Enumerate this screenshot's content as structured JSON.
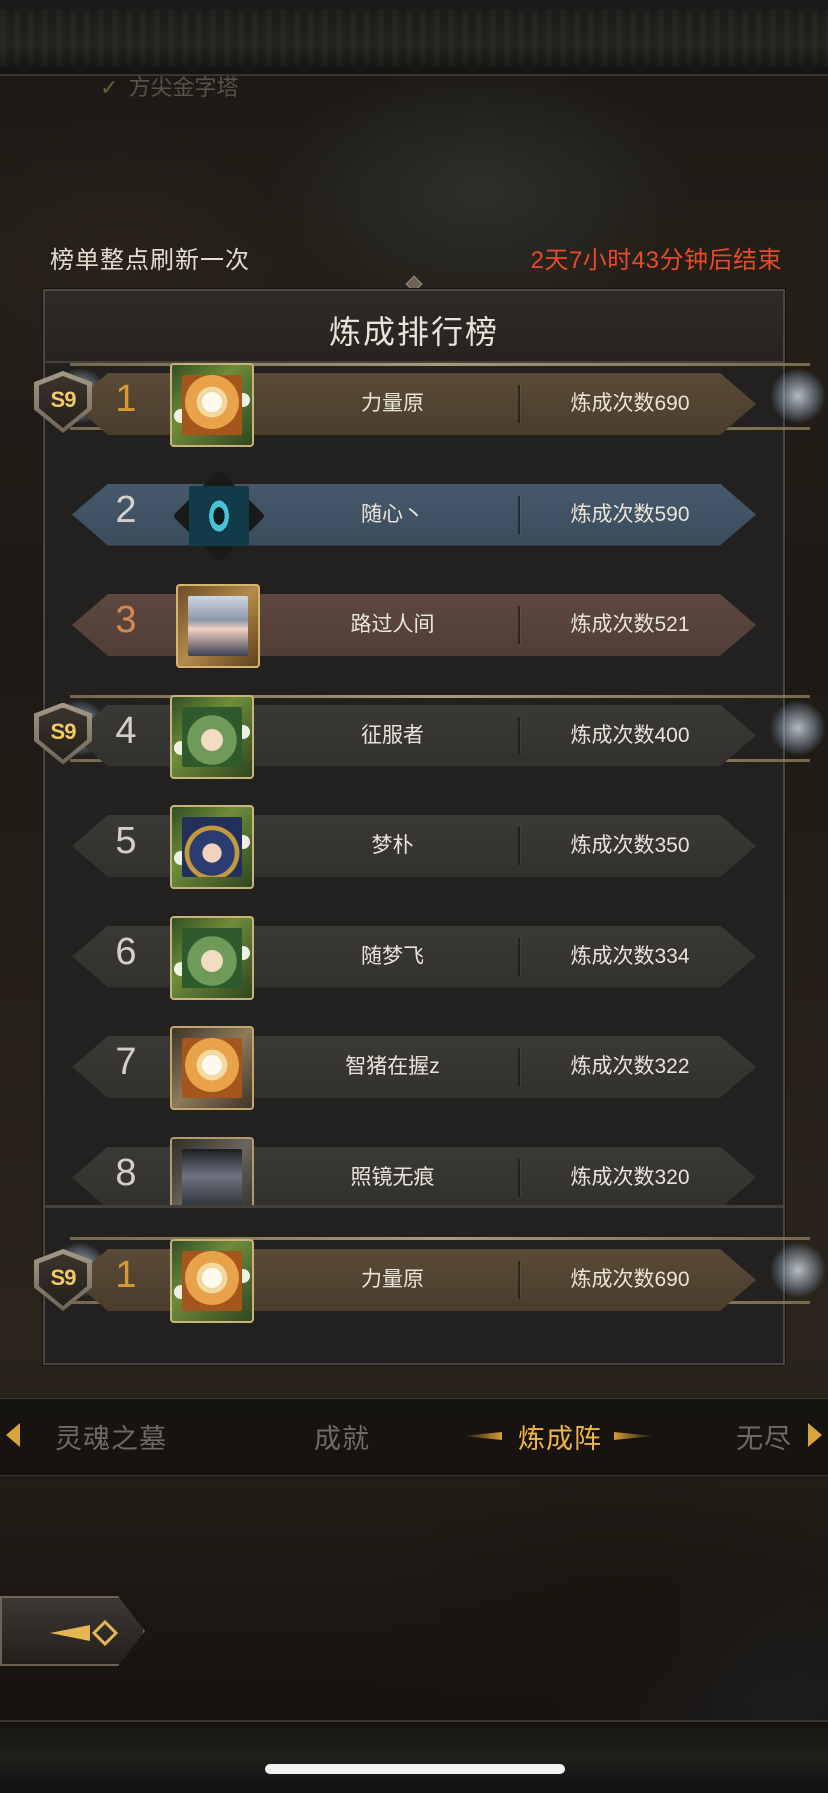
{
  "header": {
    "faded_label": "方尖金字塔",
    "refresh_note": "榜单整点刷新一次",
    "countdown": "2天7小时43分钟后结束"
  },
  "panel": {
    "title": "炼成排行榜"
  },
  "rows": [
    {
      "rank": "1",
      "name": "力量原",
      "score": "炼成次数690",
      "badge": "S9",
      "style": "gold",
      "avatar": "rabbit-avatar"
    },
    {
      "rank": "2",
      "name": "随心丶",
      "score": "炼成次数590",
      "badge": "",
      "style": "blue",
      "avatar": "eye-avatar"
    },
    {
      "rank": "3",
      "name": "路过人间",
      "score": "炼成次数521",
      "badge": "",
      "style": "bronze",
      "avatar": "elf-avatar"
    },
    {
      "rank": "4",
      "name": "征服者",
      "score": "炼成次数400",
      "badge": "S9",
      "style": "gray",
      "avatar": "green-hair-avatar"
    },
    {
      "rank": "5",
      "name": "梦朴",
      "score": "炼成次数350",
      "badge": "",
      "style": "gray",
      "avatar": "blue-hair-avatar"
    },
    {
      "rank": "6",
      "name": "随梦飞",
      "score": "炼成次数334",
      "badge": "",
      "style": "gray",
      "avatar": "green-hair-avatar"
    },
    {
      "rank": "7",
      "name": "智猪在握z",
      "score": "炼成次数322",
      "badge": "",
      "style": "gray",
      "avatar": "rabbit-avatar"
    },
    {
      "rank": "8",
      "name": "照镜无痕",
      "score": "炼成次数320",
      "badge": "",
      "style": "gray",
      "avatar": "knight-avatar"
    }
  ],
  "my_rank": {
    "rank": "1",
    "name": "力量原",
    "score": "炼成次数690",
    "badge": "S9"
  },
  "tabs": [
    {
      "label": "灵魂之墓",
      "active": false
    },
    {
      "label": "成就",
      "active": false
    },
    {
      "label": "炼成阵",
      "active": true
    },
    {
      "label": "无尽",
      "active": false
    }
  ],
  "colors": {
    "countdown": "#e94a2c",
    "active_tab": "#f0b54a",
    "gold_rank": "#d69a35",
    "bronze_rank": "#d7884f"
  }
}
